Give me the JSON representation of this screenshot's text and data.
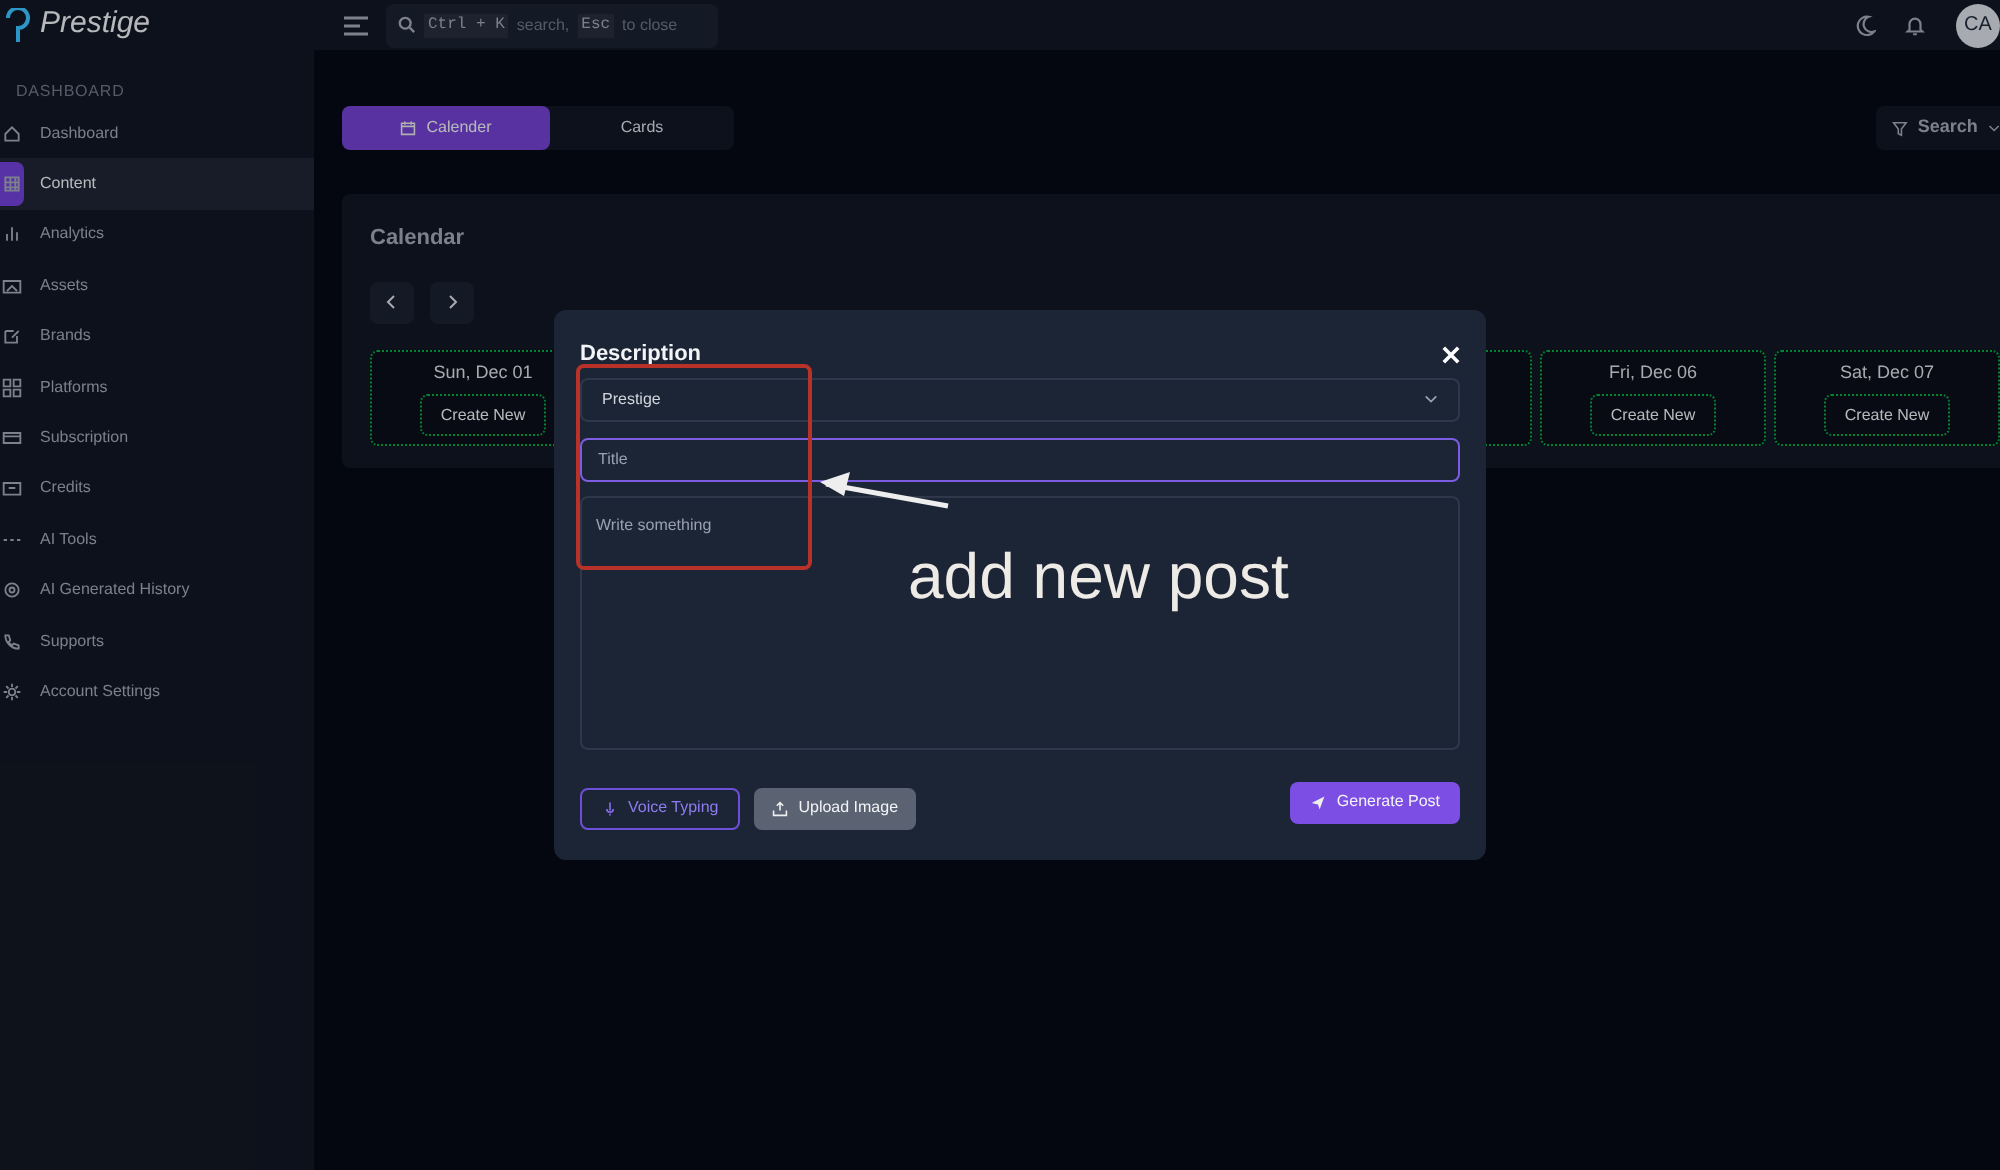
{
  "brand": {
    "name": "Prestige"
  },
  "topbar": {
    "search_placeholder": "search,",
    "shortcut_open": "Ctrl + K",
    "shortcut_close": "Esc",
    "close_hint": "to close",
    "avatar": "CA"
  },
  "sidebar": {
    "section": "DASHBOARD",
    "items": [
      {
        "label": "Dashboard",
        "selected": false
      },
      {
        "label": "Content",
        "selected": true
      },
      {
        "label": "Analytics",
        "selected": false
      },
      {
        "label": "Assets",
        "selected": false
      },
      {
        "label": "Brands",
        "selected": false
      },
      {
        "label": "Platforms",
        "selected": false
      },
      {
        "label": "Subscription",
        "selected": false
      },
      {
        "label": "Credits",
        "selected": false
      },
      {
        "label": "AI Tools",
        "selected": false
      },
      {
        "label": "AI Generated History",
        "selected": false
      },
      {
        "label": "Supports",
        "selected": false
      },
      {
        "label": "Account Settings",
        "selected": false
      }
    ]
  },
  "view_tabs": [
    {
      "label": "Calender",
      "selected": true
    },
    {
      "label": "Cards",
      "selected": false
    }
  ],
  "filter_button": "Search",
  "calendar": {
    "title": "Calendar",
    "days": [
      {
        "date": "Sun, Dec 01",
        "button": "Create New"
      },
      {
        "date": "Fri, Dec 06",
        "button": "Create New"
      },
      {
        "date": "Sat, Dec 07",
        "button": "Create New"
      }
    ]
  },
  "modal": {
    "title": "Description",
    "brand_select": "Prestige",
    "title_placeholder": "Title",
    "body_placeholder": "Write something",
    "buttons": [
      {
        "label": "Voice Typing",
        "kind": "outline"
      },
      {
        "label": "Upload Image",
        "kind": "muted"
      },
      {
        "label": "Generate Post",
        "kind": "primary"
      }
    ]
  },
  "annotation": {
    "text": "add new post"
  }
}
